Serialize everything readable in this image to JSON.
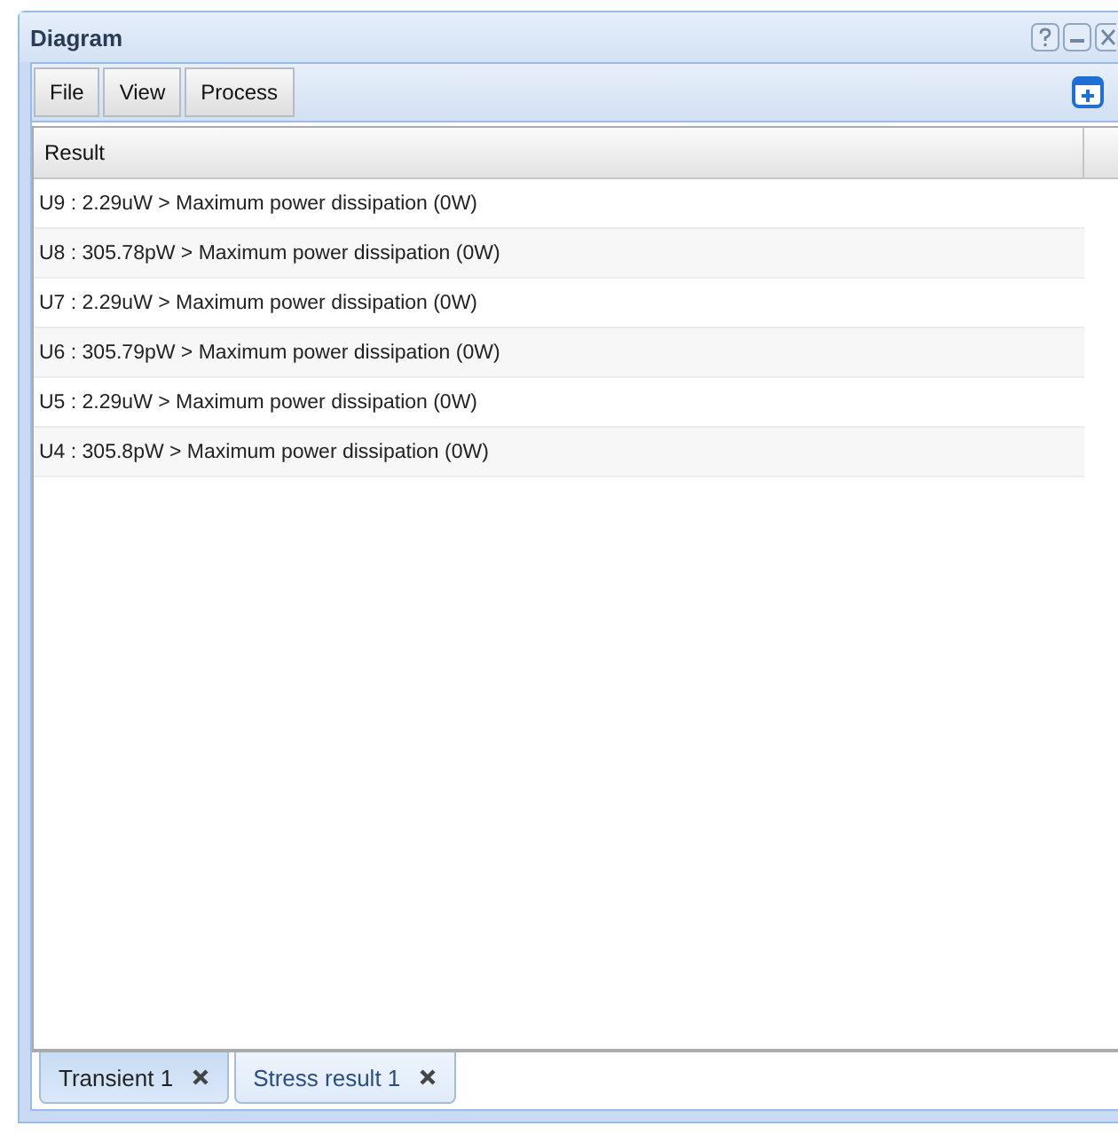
{
  "window": {
    "title": "Diagram"
  },
  "menu": [
    {
      "label": "File"
    },
    {
      "label": "View"
    },
    {
      "label": "Process"
    }
  ],
  "table": {
    "columns": [
      "Result"
    ],
    "rows": [
      "U9 : 2.29uW > Maximum power dissipation (0W)",
      "U8 : 305.78pW > Maximum power dissipation (0W)",
      "U7 : 2.29uW > Maximum power dissipation (0W)",
      "U6 : 305.79pW > Maximum power dissipation (0W)",
      "U5 : 2.29uW > Maximum power dissipation (0W)",
      "U4 : 305.8pW > Maximum power dissipation (0W)"
    ]
  },
  "tabs": [
    {
      "label": "Transient 1",
      "selected": false
    },
    {
      "label": "Stress result 1",
      "selected": true
    }
  ]
}
